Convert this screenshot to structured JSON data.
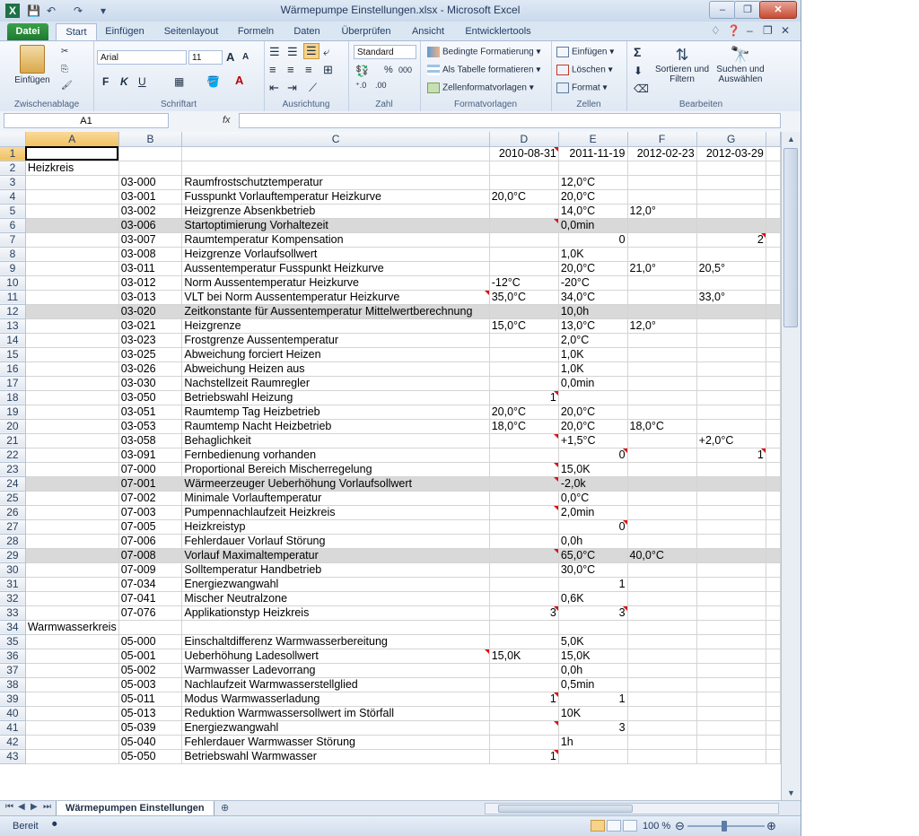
{
  "window": {
    "title": "Wärmepumpe Einstellungen.xlsx - Microsoft Excel",
    "app_icon": "X",
    "quick_access": [
      "save-icon",
      "undo-icon",
      "redo-icon",
      "customize-icon"
    ],
    "controls": {
      "minimize": "–",
      "restore": "❐",
      "close": "✕"
    }
  },
  "tabs": {
    "file": "Datei",
    "items": [
      "Start",
      "Einfügen",
      "Seitenlayout",
      "Formeln",
      "Daten",
      "Überprüfen",
      "Ansicht",
      "Entwicklertools"
    ],
    "active": "Start"
  },
  "ribbon": {
    "clipboard": {
      "label": "Zwischenablage",
      "paste": "Einfügen"
    },
    "font": {
      "label": "Schriftart",
      "name": "Arial",
      "size": "11",
      "bold": "F",
      "italic": "K",
      "underline": "U",
      "grow": "A",
      "shrink": "A"
    },
    "alignment": {
      "label": "Ausrichtung"
    },
    "number": {
      "label": "Zahl",
      "format": "Standard",
      "percent": "%",
      "thousands": "000"
    },
    "styles": {
      "label": "Formatvorlagen",
      "conditional": "Bedingte Formatierung",
      "as_table": "Als Tabelle formatieren",
      "cell_styles": "Zellenformatvorlagen"
    },
    "cells": {
      "label": "Zellen",
      "insert": "Einfügen",
      "delete": "Löschen",
      "format": "Format"
    },
    "editing": {
      "label": "Bearbeiten",
      "sum": "Σ",
      "sort": "Sortieren und Filtern",
      "find": "Suchen und Auswählen"
    }
  },
  "formula_bar": {
    "name_box": "A1",
    "fx": "fx",
    "formula": ""
  },
  "sheet": {
    "columns": [
      "A",
      "B",
      "C",
      "D",
      "E",
      "F",
      "G"
    ],
    "rows": [
      {
        "n": "1",
        "a": "",
        "b": "",
        "c": "",
        "d": "2010-08-31",
        "e": "2011-11-19",
        "f": "2012-02-23",
        "g": "2012-03-29"
      },
      {
        "n": "2",
        "a": "Heizkreis",
        "b": "",
        "c": "",
        "d": "",
        "e": "",
        "f": "",
        "g": ""
      },
      {
        "n": "3",
        "a": "",
        "b": "03-000",
        "c": "Raumfrostschutztemperatur",
        "d": "",
        "e": "12,0°C",
        "f": "",
        "g": ""
      },
      {
        "n": "4",
        "a": "",
        "b": "03-001",
        "c": "Fusspunkt Vorlauftemperatur Heizkurve",
        "d": "20,0°C",
        "e": "20,0°C",
        "f": "",
        "g": ""
      },
      {
        "n": "5",
        "a": "",
        "b": "03-002",
        "c": "Heizgrenze Absenkbetrieb",
        "d": "",
        "e": "14,0°C",
        "f": "12,0°",
        "g": ""
      },
      {
        "n": "6",
        "a": "",
        "b": "03-006",
        "c": "Startoptimierung Vorhaltezeit",
        "d": "",
        "e": "0,0min",
        "f": "",
        "g": ""
      },
      {
        "n": "7",
        "a": "",
        "b": "03-007",
        "c": "Raumtemperatur Kompensation",
        "d": "",
        "e": "0",
        "f": "",
        "g": "2"
      },
      {
        "n": "8",
        "a": "",
        "b": "03-008",
        "c": "Heizgrenze Vorlaufsollwert",
        "d": "",
        "e": "1,0K",
        "f": "",
        "g": ""
      },
      {
        "n": "9",
        "a": "",
        "b": "03-011",
        "c": "Aussentemperatur Fusspunkt Heizkurve",
        "d": "",
        "e": "20,0°C",
        "f": "21,0°",
        "g": "20,5°"
      },
      {
        "n": "10",
        "a": "",
        "b": "03-012",
        "c": "Norm Aussentemperatur Heizkurve",
        "d": "-12°C",
        "e": "-20°C",
        "f": "",
        "g": ""
      },
      {
        "n": "11",
        "a": "",
        "b": "03-013",
        "c": "VLT bei Norm Aussentemperatur Heizkurve",
        "d": "35,0°C",
        "e": "34,0°C",
        "f": "",
        "g": "33,0°"
      },
      {
        "n": "12",
        "a": "",
        "b": "03-020",
        "c": "Zeitkonstante für Aussentemperatur Mittelwertberechnung",
        "d": "",
        "e": "10,0h",
        "f": "",
        "g": ""
      },
      {
        "n": "13",
        "a": "",
        "b": "03-021",
        "c": "Heizgrenze",
        "d": "15,0°C",
        "e": "13,0°C",
        "f": "12,0°",
        "g": ""
      },
      {
        "n": "14",
        "a": "",
        "b": "03-023",
        "c": "Frostgrenze Aussentemperatur",
        "d": "",
        "e": "2,0°C",
        "f": "",
        "g": ""
      },
      {
        "n": "15",
        "a": "",
        "b": "03-025",
        "c": "Abweichung forciert Heizen",
        "d": "",
        "e": "1,0K",
        "f": "",
        "g": ""
      },
      {
        "n": "16",
        "a": "",
        "b": "03-026",
        "c": "Abweichung Heizen aus",
        "d": "",
        "e": "1,0K",
        "f": "",
        "g": ""
      },
      {
        "n": "17",
        "a": "",
        "b": "03-030",
        "c": "Nachstellzeit Raumregler",
        "d": "",
        "e": "0,0min",
        "f": "",
        "g": ""
      },
      {
        "n": "18",
        "a": "",
        "b": "03-050",
        "c": "Betriebswahl Heizung",
        "d": "1",
        "e": "",
        "f": "",
        "g": ""
      },
      {
        "n": "19",
        "a": "",
        "b": "03-051",
        "c": "Raumtemp Tag Heizbetrieb",
        "d": "20,0°C",
        "e": "20,0°C",
        "f": "",
        "g": ""
      },
      {
        "n": "20",
        "a": "",
        "b": "03-053",
        "c": "Raumtemp Nacht Heizbetrieb",
        "d": "18,0°C",
        "e": "20,0°C",
        "f": "18,0°C",
        "g": ""
      },
      {
        "n": "21",
        "a": "",
        "b": "03-058",
        "c": "Behaglichkeit",
        "d": "",
        "e": "+1,5°C",
        "f": "",
        "g": "+2,0°C"
      },
      {
        "n": "22",
        "a": "",
        "b": "03-091",
        "c": "Fernbedienung vorhanden",
        "d": "",
        "e": "0",
        "f": "",
        "g": "1"
      },
      {
        "n": "23",
        "a": "",
        "b": "07-000",
        "c": "Proportional Bereich Mischerregelung",
        "d": "",
        "e": "15,0K",
        "f": "",
        "g": ""
      },
      {
        "n": "24",
        "a": "",
        "b": "07-001",
        "c": "Wärmeerzeuger Ueberhöhung Vorlaufsollwert",
        "d": "",
        "e": "-2,0k",
        "f": "",
        "g": ""
      },
      {
        "n": "25",
        "a": "",
        "b": "07-002",
        "c": "Minimale Vorlauftemperatur",
        "d": "",
        "e": "0,0°C",
        "f": "",
        "g": ""
      },
      {
        "n": "26",
        "a": "",
        "b": "07-003",
        "c": "Pumpennachlaufzeit Heizkreis",
        "d": "",
        "e": "2,0min",
        "f": "",
        "g": ""
      },
      {
        "n": "27",
        "a": "",
        "b": "07-005",
        "c": "Heizkreistyp",
        "d": "",
        "e": "0",
        "f": "",
        "g": ""
      },
      {
        "n": "28",
        "a": "",
        "b": "07-006",
        "c": "Fehlerdauer Vorlauf Störung",
        "d": "",
        "e": "0,0h",
        "f": "",
        "g": ""
      },
      {
        "n": "29",
        "a": "",
        "b": "07-008",
        "c": "Vorlauf Maximaltemperatur",
        "d": "",
        "e": "65,0°C",
        "f": "40,0°C",
        "g": ""
      },
      {
        "n": "30",
        "a": "",
        "b": "07-009",
        "c": "Solltemperatur Handbetrieb",
        "d": "",
        "e": "30,0°C",
        "f": "",
        "g": ""
      },
      {
        "n": "31",
        "a": "",
        "b": "07-034",
        "c": "Energiezwangwahl",
        "d": "",
        "e": "1",
        "f": "",
        "g": ""
      },
      {
        "n": "32",
        "a": "",
        "b": "07-041",
        "c": "Mischer Neutralzone",
        "d": "",
        "e": "0,6K",
        "f": "",
        "g": ""
      },
      {
        "n": "33",
        "a": "",
        "b": "07-076",
        "c": "Applikationstyp Heizkreis",
        "d": "3",
        "e": "3",
        "f": "",
        "g": ""
      },
      {
        "n": "34",
        "a": "Warmwasserkreis",
        "b": "",
        "c": "",
        "d": "",
        "e": "",
        "f": "",
        "g": ""
      },
      {
        "n": "35",
        "a": "",
        "b": "05-000",
        "c": "Einschaltdifferenz Warmwasserbereitung",
        "d": "",
        "e": "5,0K",
        "f": "",
        "g": ""
      },
      {
        "n": "36",
        "a": "",
        "b": "05-001",
        "c": "Ueberhöhung Ladesollwert",
        "d": "15,0K",
        "e": "15,0K",
        "f": "",
        "g": ""
      },
      {
        "n": "37",
        "a": "",
        "b": "05-002",
        "c": "Warmwasser Ladevorrang",
        "d": "",
        "e": "0,0h",
        "f": "",
        "g": ""
      },
      {
        "n": "38",
        "a": "",
        "b": "05-003",
        "c": "Nachlaufzeit Warmwasserstellglied",
        "d": "",
        "e": "0,5min",
        "f": "",
        "g": ""
      },
      {
        "n": "39",
        "a": "",
        "b": "05-011",
        "c": "Modus Warmwasserladung",
        "d": "1",
        "e": "1",
        "f": "",
        "g": ""
      },
      {
        "n": "40",
        "a": "",
        "b": "05-013",
        "c": "Reduktion Warmwassersollwert im Störfall",
        "d": "",
        "e": "10K",
        "f": "",
        "g": ""
      },
      {
        "n": "41",
        "a": "",
        "b": "05-039",
        "c": "Energiezwangwahl",
        "d": "",
        "e": "3",
        "f": "",
        "g": ""
      },
      {
        "n": "42",
        "a": "",
        "b": "05-040",
        "c": "Fehlerdauer Warmwasser Störung",
        "d": "",
        "e": "1h",
        "f": "",
        "g": ""
      },
      {
        "n": "43",
        "a": "",
        "b": "05-050",
        "c": "Betriebswahl Warmwasser",
        "d": "1",
        "e": "",
        "f": "",
        "g": ""
      }
    ]
  },
  "sheet_tab": "Wärmepumpen Einstellungen",
  "status": {
    "ready": "Bereit",
    "zoom": "100 %"
  },
  "colors": {
    "file_tab": "#1f7a2f",
    "gray_row": "#d9d9d9",
    "comment_marker": "#dd1111",
    "selection_header": "#f1c15f"
  }
}
